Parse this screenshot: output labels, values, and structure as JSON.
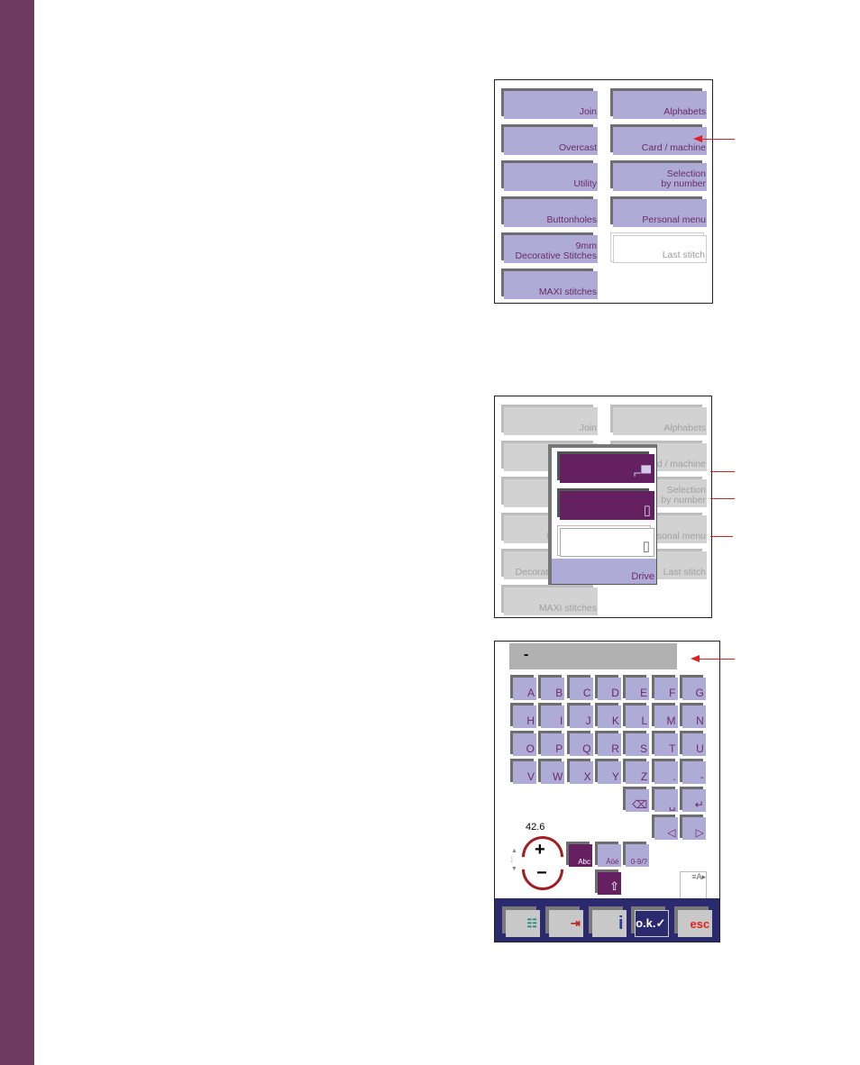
{
  "colors": {
    "stripe": "#6b3a5e",
    "button_face": "#aeabd6",
    "button_text": "#6b2a6a",
    "popup_item": "#652062",
    "navbar": "#2b2a6e",
    "annotation": "#e02020"
  },
  "stitch_menu": {
    "buttons": [
      {
        "label": "Join"
      },
      {
        "label": "Alphabets"
      },
      {
        "label": "Overcast"
      },
      {
        "label": "Card / machine"
      },
      {
        "label": "Utility"
      },
      {
        "label": "Selection\nby number"
      },
      {
        "label": "Buttonholes"
      },
      {
        "label": "Personal menu"
      },
      {
        "label": "9mm\nDecorative Stitches"
      },
      {
        "label": "Last stitch",
        "inactive": true
      },
      {
        "label": "MAXI stitches"
      }
    ]
  },
  "drive_popup": {
    "items": [
      {
        "icon": "sewing-machine-icon"
      },
      {
        "icon": "card-icon"
      },
      {
        "icon": "card-icon",
        "empty": true
      }
    ],
    "title": "Drive"
  },
  "keyboard": {
    "input_value": "-",
    "keys": [
      "A",
      "B",
      "C",
      "D",
      "E",
      "F",
      "G",
      "H",
      "I",
      "J",
      "K",
      "L",
      "M",
      "N",
      "O",
      "P",
      "Q",
      "R",
      "S",
      "T",
      "U",
      "V",
      "W",
      "X",
      "Y",
      "Z",
      ".",
      "-"
    ],
    "special_keys": [
      {
        "name": "eraser",
        "glyph": "⌫"
      },
      {
        "name": "space",
        "glyph": "␣"
      },
      {
        "name": "enter",
        "glyph": "↵"
      },
      {
        "name": "cursor-left",
        "glyph": "◁"
      },
      {
        "name": "cursor-right",
        "glyph": "▷"
      }
    ],
    "modes": [
      "Abc",
      "Äöé",
      "0-9/?"
    ],
    "shift_glyph": "⇧",
    "dial_value": "42.6",
    "nav": [
      {
        "name": "menu",
        "glyph": "☷"
      },
      {
        "name": "exit",
        "glyph": "⇥"
      },
      {
        "name": "info",
        "glyph": "i"
      },
      {
        "name": "ok",
        "glyph": "o.k.✓"
      },
      {
        "name": "esc",
        "glyph": "esc"
      }
    ]
  }
}
